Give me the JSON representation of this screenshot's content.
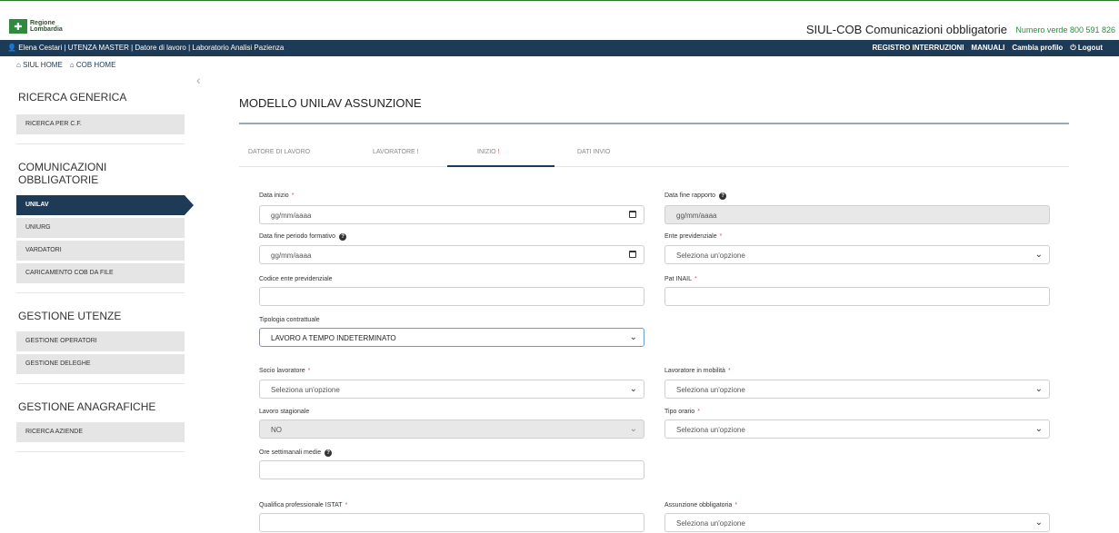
{
  "header": {
    "logo_line1": "Regione",
    "logo_line2": "Lombardia",
    "app_title": "SIUL-COB Comunicazioni obbligatorie",
    "phone": "Numero verde 800 591 826"
  },
  "userbar": {
    "user_info": "Elena Cestari | UTENZA MASTER | Datore di lavoro | Laboratorio Analisi Pazienza",
    "links": [
      "REGISTRO INTERRUZIONI",
      "MANUALI",
      "Cambia profilo",
      "Logout"
    ]
  },
  "breadcrumbs": [
    "SIUL HOME",
    "COB HOME"
  ],
  "sidebar": {
    "sections": [
      {
        "title": "RICERCA GENERICA",
        "items": [
          "RICERCA PER C.F."
        ]
      },
      {
        "title": "COMUNICAZIONI OBBLIGATORIE",
        "items": [
          "UNILAV",
          "UNIURG",
          "VARDATORI",
          "CARICAMENTO COB DA FILE"
        ]
      },
      {
        "title": "GESTIONE UTENZE",
        "items": [
          "GESTIONE OPERATORI",
          "GESTIONE DELEGHE"
        ]
      },
      {
        "title": "GESTIONE ANAGRAFICHE",
        "items": [
          "RICERCA AZIENDE"
        ]
      }
    ],
    "active_item": "UNILAV"
  },
  "page_title": "MODELLO UNILAV ASSUNZIONE",
  "tabs": [
    {
      "label": "DATORE DI LAVORO",
      "flag": ""
    },
    {
      "label": "LAVORATORE",
      "flag": "!"
    },
    {
      "label": "INIZIO",
      "flag": "!"
    },
    {
      "label": "DATI INVIO",
      "flag": ""
    }
  ],
  "form": {
    "data_inizio": {
      "label": "Data inizio",
      "required": "*",
      "placeholder": "gg/mm/aaaa"
    },
    "data_fine_rapporto": {
      "label": "Data fine rapporto",
      "placeholder": "gg/mm/aaaa"
    },
    "data_fine_periodo_formativo": {
      "label": "Data fine periodo formativo",
      "placeholder": "gg/mm/aaaa"
    },
    "ente_previdenziale": {
      "label": "Ente previdenziale",
      "required": "*",
      "value": "Seleziona un'opzione"
    },
    "codice_ente_previdenziale": {
      "label": "Codice ente previdenziale",
      "value": ""
    },
    "pat_inail": {
      "label": "Pat INAIL",
      "required": "*",
      "value": ""
    },
    "tipologia_contrattuale": {
      "label": "Tipologia contrattuale",
      "value": "LAVORO A TEMPO INDETERMINATO"
    },
    "socio_lavoratore": {
      "label": "Socio lavoratore",
      "required": "*",
      "value": "Seleziona un'opzione"
    },
    "lavoratore_mobilita": {
      "label": "Lavoratore in mobilità",
      "required": "*",
      "value": "Seleziona un'opzione"
    },
    "lavoro_stagionale": {
      "label": "Lavoro stagionale",
      "value": "NO"
    },
    "tipo_orario": {
      "label": "Tipo orario",
      "required": "*",
      "value": "Seleziona un'opzione"
    },
    "ore_settimanali": {
      "label": "Ore settimanali medie",
      "value": ""
    },
    "qualifica_istat": {
      "label": "Qualifica professionale ISTAT",
      "required": "*",
      "value": ""
    },
    "assunzione_obbligatoria": {
      "label": "Assunzione obbligatoria",
      "required": "*",
      "value": "Seleziona un'opzione"
    }
  }
}
